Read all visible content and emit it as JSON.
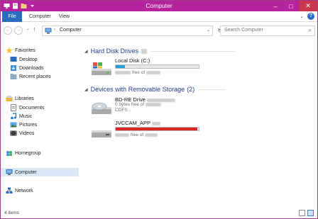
{
  "window": {
    "title": "Computer",
    "minimize": "–",
    "maximize": "□",
    "close": "✕"
  },
  "ribbon": {
    "tabs": [
      "File",
      "Computer",
      "View"
    ],
    "expand_glyph": "⌄",
    "help_glyph": "?"
  },
  "address_bar": {
    "back_glyph": "←",
    "forward_glyph": "→",
    "recent_glyph": "⌄",
    "up_glyph": "↑",
    "separator": "›",
    "path": "Computer",
    "dropdown_glyph": "⌄",
    "refresh_glyph": "↻"
  },
  "search": {
    "placeholder": "Search Computer",
    "icon_glyph": "⌕"
  },
  "nav_pane": {
    "favorites": {
      "label": "Favorites",
      "items": [
        "Desktop",
        "Downloads",
        "Recent places"
      ]
    },
    "libraries": {
      "label": "Libraries",
      "items": [
        "Documents",
        "Music",
        "Pictures",
        "Videos"
      ]
    },
    "homegroup": "Homegroup",
    "computer": "Computer",
    "network": "Network"
  },
  "groups": {
    "hard_disks": {
      "label": "Hard Disk Drives",
      "arrow": "◢"
    },
    "removable": {
      "label": "Devices with Removable Storage",
      "count": "(2)",
      "arrow": "◢"
    }
  },
  "drives": {
    "local_disk": {
      "name": "Local Disk (C:)",
      "free_label": "free of",
      "usage_fraction": 0.11,
      "bar_color": "#26a0da"
    },
    "bd_drive": {
      "name": "BD-RE Drive",
      "line2": "0 bytes free of",
      "line3": "CDFS"
    },
    "jvccam": {
      "name": "JVCCAM_APP",
      "free_label": "free of",
      "usage_fraction": 0.98,
      "bar_color": "#da2626"
    }
  },
  "status": {
    "item_count": "4 items"
  },
  "colors": {
    "titlebar": "#b6239f",
    "file_tab": "#2a6cbf",
    "group_header": "#1e3c8c",
    "selection": "#d9e8f7"
  }
}
